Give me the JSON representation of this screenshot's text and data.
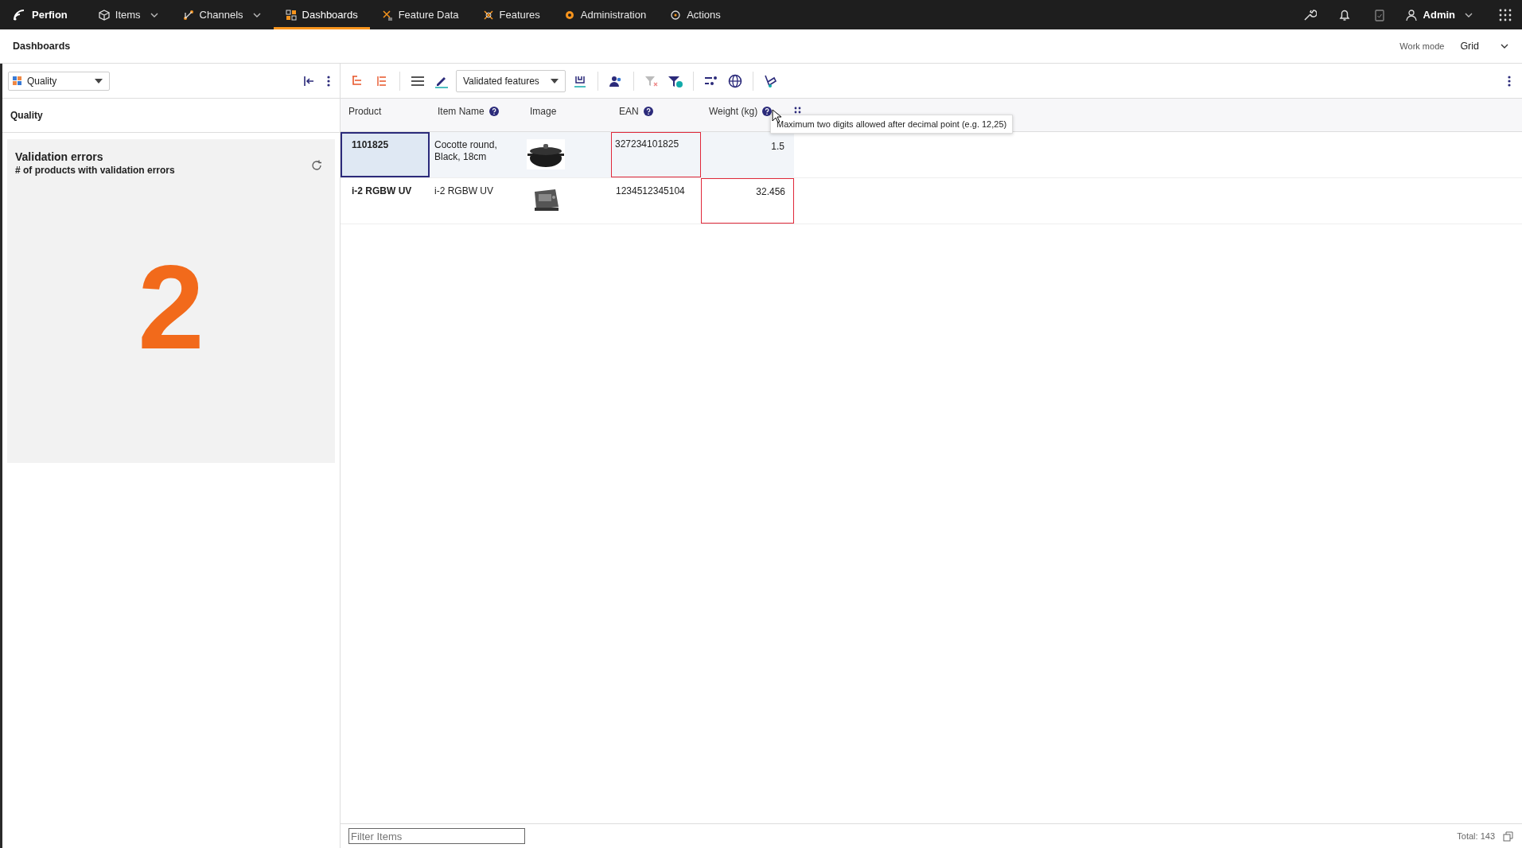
{
  "nav": {
    "brand": "Perfion",
    "items": [
      {
        "label": "Items",
        "dropdown": true,
        "selected": false
      },
      {
        "label": "Channels",
        "dropdown": true,
        "selected": false
      },
      {
        "label": "Dashboards",
        "dropdown": false,
        "selected": true
      },
      {
        "label": "Feature Data",
        "dropdown": false,
        "selected": false
      },
      {
        "label": "Features",
        "dropdown": false,
        "selected": false
      },
      {
        "label": "Administration",
        "dropdown": false,
        "selected": false
      },
      {
        "label": "Actions",
        "dropdown": false,
        "selected": false
      }
    ],
    "user": "Admin"
  },
  "header": {
    "title": "Dashboards",
    "work_mode_label": "Work mode",
    "work_mode": "Grid"
  },
  "sidebar": {
    "dashboard_select": "Quality",
    "section": "Quality",
    "card": {
      "title": "Validation errors",
      "subtitle": "# of products with validation errors",
      "value": "2"
    }
  },
  "toolbar": {
    "view_select": "Validated features"
  },
  "grid": {
    "columns": [
      {
        "label": "Product",
        "help": false
      },
      {
        "label": "Item Name",
        "help": true
      },
      {
        "label": "Image",
        "help": false
      },
      {
        "label": "EAN",
        "help": true
      },
      {
        "label": "Weight (kg)",
        "help": true
      }
    ],
    "rows": [
      {
        "highlighted": true,
        "cells": [
          {
            "kind": "text",
            "text": "1101825",
            "selected": true,
            "error": false
          },
          {
            "kind": "text",
            "text": "Cocotte round, Black, 18cm",
            "selected": false,
            "error": false
          },
          {
            "kind": "picture",
            "selected": false,
            "error": false
          },
          {
            "kind": "text",
            "text": "327234101825",
            "selected": false,
            "error": true
          },
          {
            "kind": "number",
            "text": "1.5",
            "selected": false,
            "error": false
          }
        ]
      },
      {
        "highlighted": false,
        "cells": [
          {
            "kind": "text",
            "text": "i-2 RGBW UV",
            "selected": false,
            "error": false
          },
          {
            "kind": "text",
            "text": "i-2 RGBW UV",
            "selected": false,
            "error": false
          },
          {
            "kind": "picture",
            "selected": false,
            "error": false
          },
          {
            "kind": "text",
            "text": "1234512345104",
            "selected": false,
            "error": false
          },
          {
            "kind": "number",
            "text": "32.456",
            "selected": false,
            "error": true
          }
        ]
      }
    ],
    "tooltip": "Maximum two digits allowed after decimal point (e.g. 12,25)"
  },
  "footer": {
    "filter": {
      "placeholder": "Filter Items"
    },
    "total": "Total: 143"
  }
}
